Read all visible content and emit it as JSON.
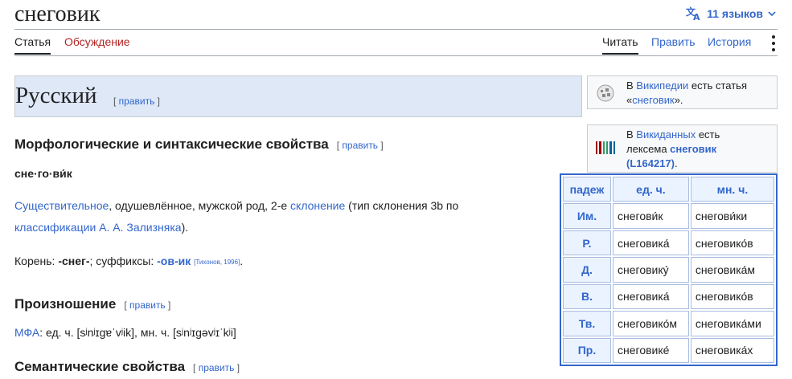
{
  "page": {
    "title": "снеговик"
  },
  "languages": {
    "label": "11 языков",
    "icon": "translate-icon",
    "chevron": "chevron-down-icon"
  },
  "tabs": {
    "left": [
      {
        "label": "Статья",
        "active": true
      },
      {
        "label": "Обсуждение",
        "active": false
      }
    ],
    "right": [
      {
        "label": "Читать",
        "active": true
      },
      {
        "label": "Править",
        "active": false
      },
      {
        "label": "История",
        "active": false
      }
    ],
    "more_icon": "more-vertical-icon"
  },
  "lang_section": {
    "title": "Русский",
    "edit": "править"
  },
  "morph": {
    "heading": "Морфологические и синтаксические свойства",
    "edit": "править",
    "syllables": "сне·го·ви́к",
    "pos_link": "Существительное",
    "pos_text": ", одушевлённое, мужской род, 2-е ",
    "decl_link": "склонение",
    "decl_text": " (тип склонения 3b по",
    "classif_link": "классификации А. А. Зализняка",
    "classif_end": ").",
    "root_label": "Корень: ",
    "root": "-снег-",
    "suffix_label": "; суффиксы: ",
    "suffix": "-ов-ик",
    "source": "[Тихонов, 1996]",
    "end": "."
  },
  "pron": {
    "heading": "Произношение",
    "edit": "править",
    "ipa_link": "МФА",
    "ipa_text": ": ед. ч. [sʲnʲɪɡɐˈvʲik], мн. ч. [sʲnʲɪɡəvʲɪˈkʲi]"
  },
  "sem": {
    "heading": "Семантические свойства",
    "edit": "править"
  },
  "wikipedia_box": {
    "icon": "wikipedia-globe-icon",
    "prefix": "В ",
    "link": "Википедии",
    "middle": " есть статья",
    "quote_open": "«",
    "article": "снеговик",
    "quote_close": "»."
  },
  "wikidata_box": {
    "icon": "wikidata-barcode-icon",
    "prefix": "В ",
    "link": "Викиданных",
    "middle": " есть",
    "line2": "лексема ",
    "lexeme": "снеговик",
    "lexeme_id": "(L164217)",
    "end": "."
  },
  "inflection": {
    "headers": [
      "падеж",
      "ед. ч.",
      "мн. ч."
    ],
    "rows": [
      {
        "case": "Им.",
        "sg": "снегови́к",
        "pl": "снегови́ки"
      },
      {
        "case": "Р.",
        "sg": "снеговика́",
        "pl": "снеговико́в"
      },
      {
        "case": "Д.",
        "sg": "снеговику́",
        "pl": "снеговика́м"
      },
      {
        "case": "В.",
        "sg": "снеговика́",
        "pl": "снеговико́в"
      },
      {
        "case": "Тв.",
        "sg": "снеговико́м",
        "pl": "снеговика́ми"
      },
      {
        "case": "Пр.",
        "sg": "снеговике́",
        "pl": "снеговика́х"
      }
    ]
  },
  "colors": {
    "link": "#3366cc",
    "red_link": "#b32424",
    "lang_header_bg": "#dee8f6",
    "table_border": "#3366cc"
  }
}
